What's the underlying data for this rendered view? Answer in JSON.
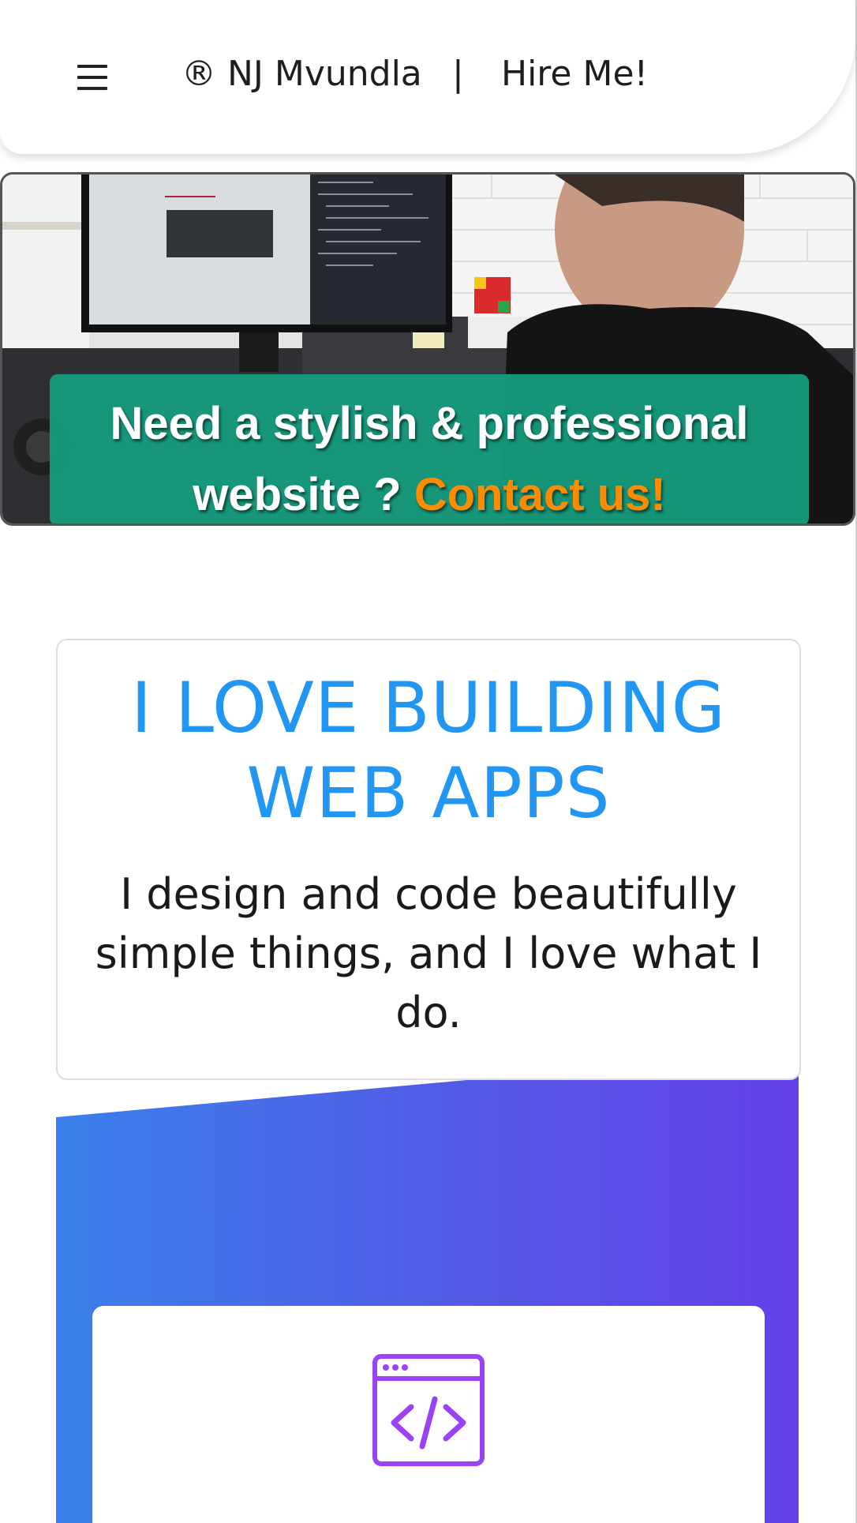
{
  "header": {
    "brand": "® NJ Mvundla",
    "separator": "|",
    "hire_label": "Hire Me!",
    "menu_icon": "hamburger-menu-icon"
  },
  "hero": {
    "image": "developer-at-desk-with-code-monitor",
    "cta_line1": "Need a stylish & professional",
    "cta_line2_prefix": "website ? ",
    "cta_link": "Contact us!",
    "cta_bg_color": "#16a080",
    "cta_link_color": "#ff8c00"
  },
  "intro": {
    "title": "I LOVE BUILDING WEB APPS",
    "subtitle": "I design and code beautifully simple things, and I love what I do.",
    "title_color": "#2196f3"
  },
  "services": {
    "gradient_start": "#3a80ea",
    "gradient_end": "#6440ea",
    "card_icon": "code-window-icon",
    "icon_color": "#9a42f5"
  }
}
